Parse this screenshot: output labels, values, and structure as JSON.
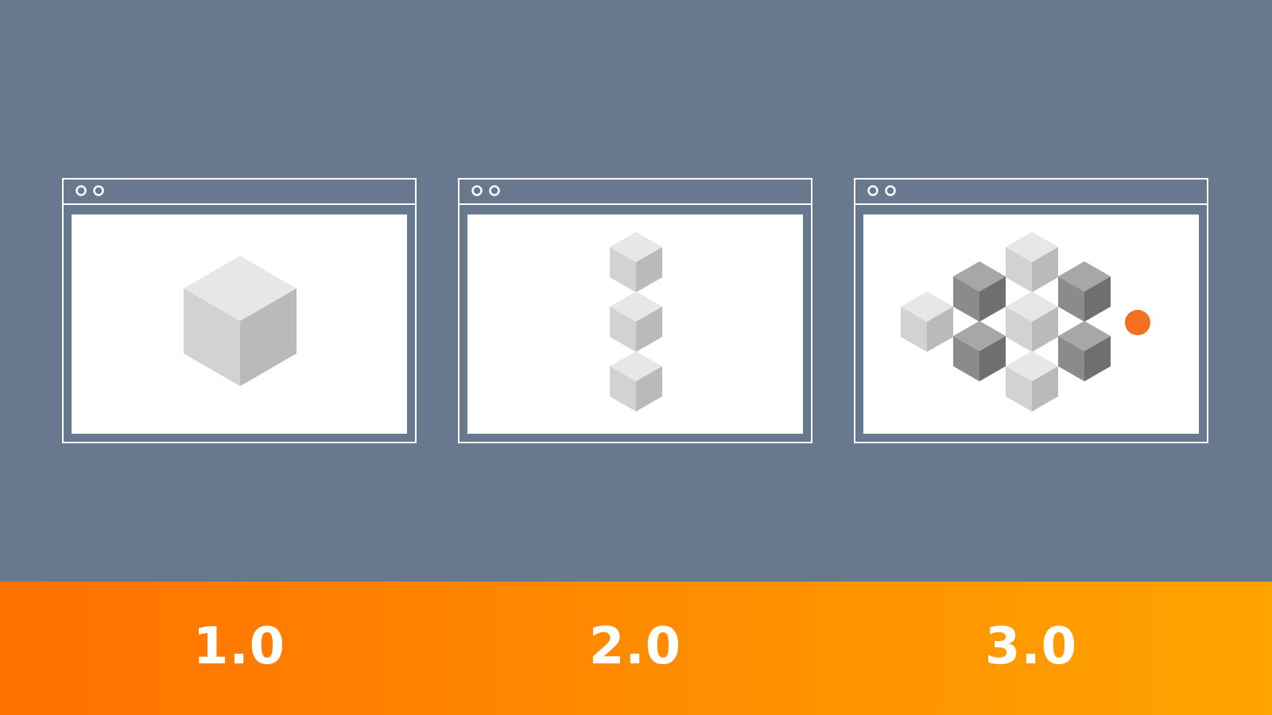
{
  "colors": {
    "background": "#68788e",
    "window_frame": "#ffffff",
    "band_start": "#ff7100",
    "band_end": "#ffa300",
    "accent_dot": "#f37021",
    "cube_light_top": "#e6e7e8",
    "cube_light_left": "#d1d2d4",
    "cube_light_right": "#b9bbbb",
    "cube_dark_top": "#a6a7a9",
    "cube_dark_left": "#8a8b8d",
    "cube_dark_right": "#6e6f71"
  },
  "stages": [
    {
      "label": "1.0",
      "icon": "single-cube-icon"
    },
    {
      "label": "2.0",
      "icon": "stacked-cubes-icon"
    },
    {
      "label": "3.0",
      "icon": "cube-cluster-icon"
    }
  ]
}
